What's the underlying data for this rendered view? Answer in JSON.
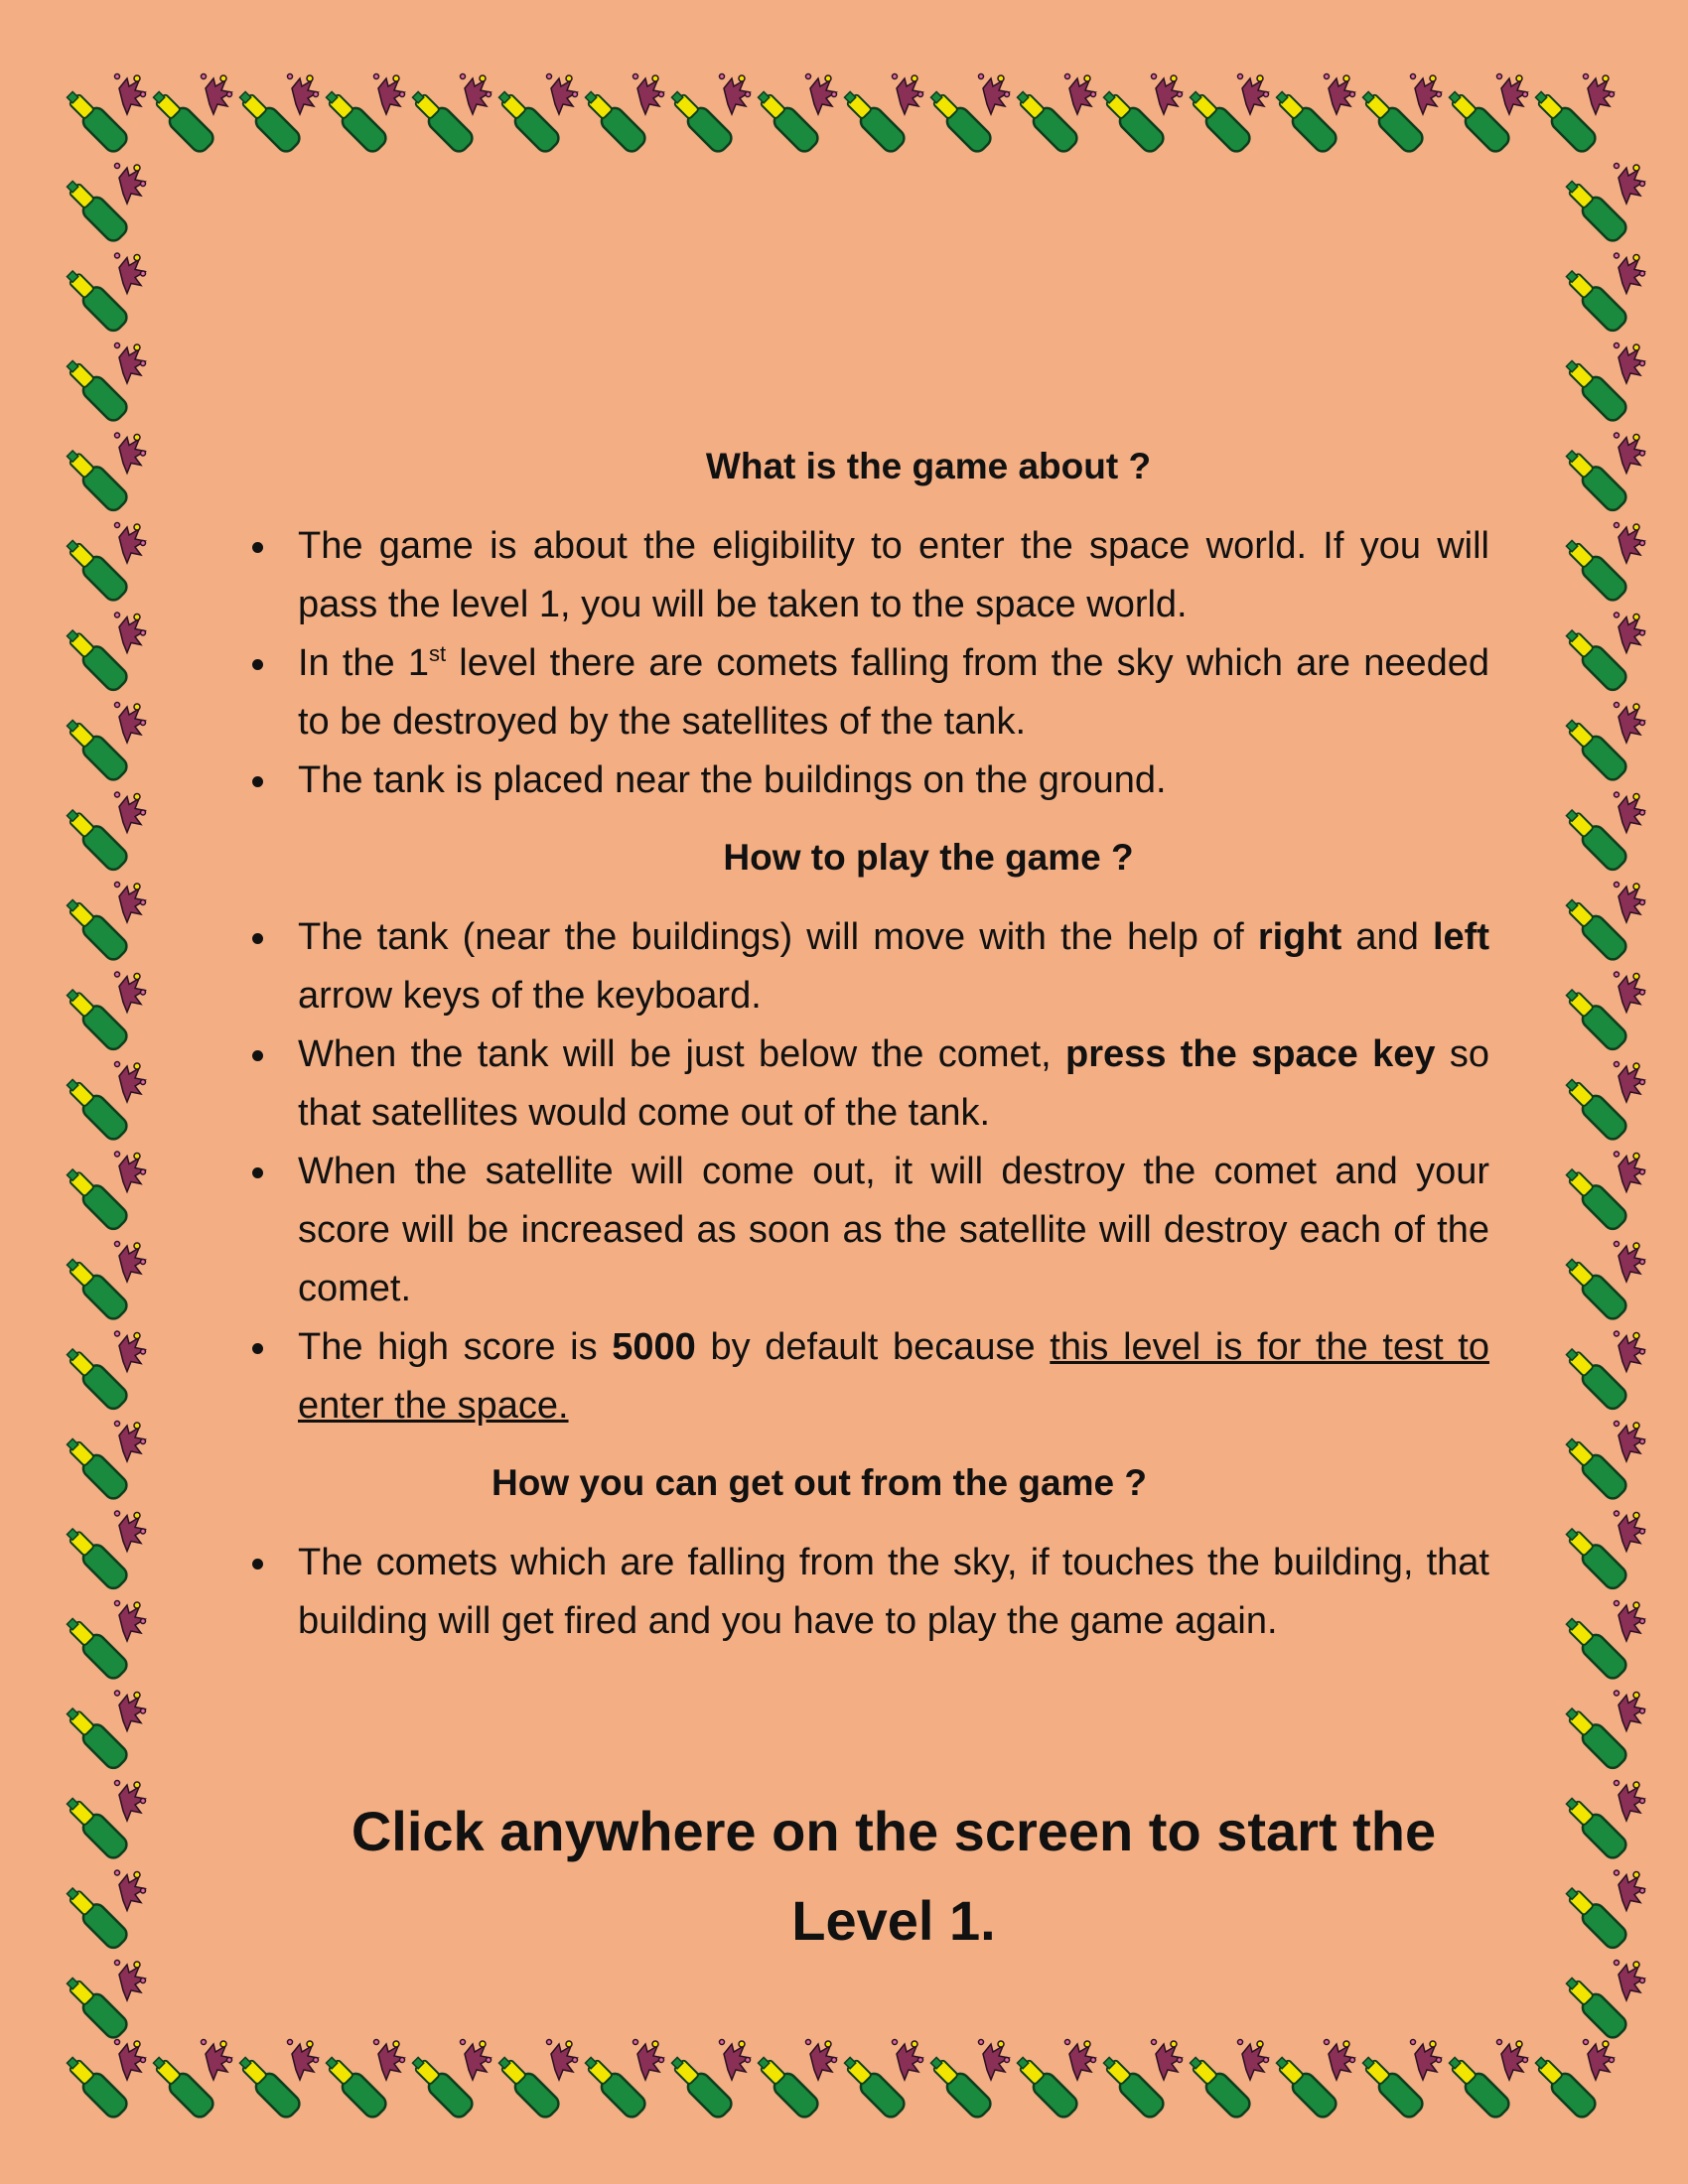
{
  "border": {
    "icon": "champagne-bottle-icon",
    "bottle_color": "#1a8a3e",
    "label_color": "#f2e600",
    "burst_color": "#8a2f55"
  },
  "sections": [
    {
      "heading": "What is the game about ?",
      "items": [
        {
          "parts": [
            {
              "text": "The game is about the eligibility to enter the space world. If you will pass the level 1, you will be taken to the space world."
            }
          ]
        },
        {
          "parts": [
            {
              "text": "In the 1"
            },
            {
              "text": "st",
              "style": "sup"
            },
            {
              "text": " level there are comets falling from the sky which are needed to be destroyed by the satellites of the tank."
            }
          ]
        },
        {
          "parts": [
            {
              "text": "The tank is placed near the buildings on the ground."
            }
          ]
        }
      ]
    },
    {
      "heading": "How to play the game ?",
      "items": [
        {
          "parts": [
            {
              "text": "The tank (near the buildings) will move with the help of "
            },
            {
              "text": "right",
              "style": "bold"
            },
            {
              "text": " and "
            },
            {
              "text": "left",
              "style": "bold"
            },
            {
              "text": " arrow keys of the keyboard."
            }
          ]
        },
        {
          "parts": [
            {
              "text": "When the tank will be just below the comet, "
            },
            {
              "text": "press the space key",
              "style": "bold"
            },
            {
              "text": " so that satellites would come out of the tank."
            }
          ]
        },
        {
          "parts": [
            {
              "text": "When the satellite will come out, it will destroy the comet and your score will be increased as soon as the satellite will destroy each of the comet."
            }
          ]
        },
        {
          "parts": [
            {
              "text": "The high score is "
            },
            {
              "text": "5000",
              "style": "bold"
            },
            {
              "text": " by default because "
            },
            {
              "text": "this level is for the test to enter the space.",
              "style": "underline"
            }
          ]
        }
      ]
    },
    {
      "heading": "How you can get out from the game ?",
      "items": [
        {
          "parts": [
            {
              "text": "The comets which are falling from the sky, if touches the building, that building will get fired and you have to play the game again."
            }
          ]
        }
      ]
    }
  ],
  "cta": {
    "line1": "Click anywhere on the screen to start the",
    "line2": "Level 1."
  }
}
